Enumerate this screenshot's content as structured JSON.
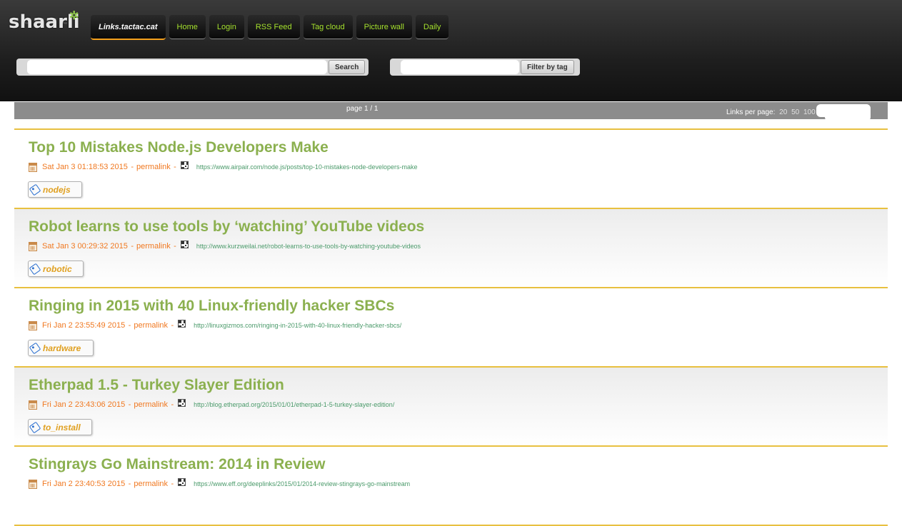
{
  "header": {
    "logo_text": "shaarli",
    "nav": [
      {
        "label": "Links.tactac.cat",
        "active": true
      },
      {
        "label": "Home"
      },
      {
        "label": "Login"
      },
      {
        "label": "RSS Feed"
      },
      {
        "label": "Tag cloud"
      },
      {
        "label": "Picture wall"
      },
      {
        "label": "Daily"
      }
    ],
    "search": {
      "button_label": "Search",
      "value": ""
    },
    "tag_filter": {
      "button_label": "Filter by tag",
      "value": ""
    }
  },
  "paging": {
    "page_info": "page 1 / 1",
    "links_per_page_label": "Links per page:",
    "options": [
      "20",
      "50",
      "100"
    ]
  },
  "links": [
    {
      "title": "Top 10 Mistakes Node.js Developers Make",
      "date": "Sat Jan 3 01:18:53 2015",
      "permalink": "permalink",
      "url": "https://www.airpair.com/node.js/posts/top-10-mistakes-node-developers-make",
      "tag": "nodejs"
    },
    {
      "title": "Robot learns to use tools by ‘watching’ YouTube videos",
      "date": "Sat Jan 3 00:29:32 2015",
      "permalink": "permalink",
      "url": "http://www.kurzweilai.net/robot-learns-to-use-tools-by-watching-youtube-videos",
      "tag": "robotic"
    },
    {
      "title": "Ringing in 2015 with 40 Linux-friendly hacker SBCs",
      "date": "Fri Jan 2 23:55:49 2015",
      "permalink": "permalink",
      "url": "http://linuxgizmos.com/ringing-in-2015-with-40-linux-friendly-hacker-sbcs/",
      "tag": "hardware"
    },
    {
      "title": "Etherpad 1.5 - Turkey Slayer Edition",
      "date": "Fri Jan 2 23:43:06 2015",
      "permalink": "permalink",
      "url": "http://blog.etherpad.org/2015/01/01/etherpad-1-5-turkey-slayer-edition/",
      "tag": "to_install"
    },
    {
      "title": "Stingrays Go Mainstream: 2014 in Review",
      "date": "Fri Jan 2 23:40:53 2015",
      "permalink": "permalink",
      "url": "https://www.eff.org/deeplinks/2015/01/2014-review-stingrays-go-mainstream",
      "tag": ""
    }
  ],
  "sep": "-",
  "colors": {
    "title": "#8bb04f",
    "meta": "#f07820",
    "url": "#4a9a6a",
    "tag": "#e0a020",
    "nav_text": "#a6e22e",
    "divider": "#e8c040"
  }
}
